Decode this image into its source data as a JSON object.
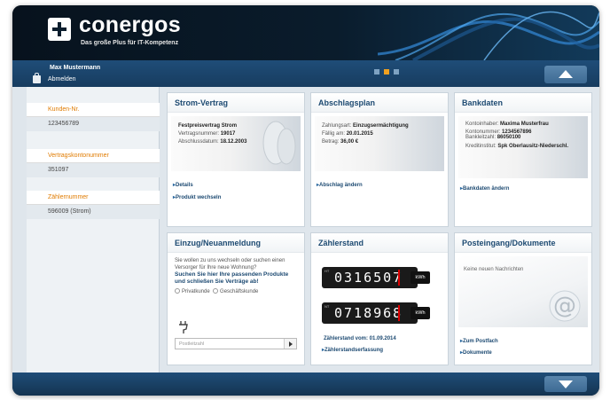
{
  "brand": {
    "name": "conergos",
    "tagline": "Das große Plus für IT-Kompetenz"
  },
  "user": {
    "name": "Max Mustermann",
    "logout_label": "Abmelden"
  },
  "sidebar": {
    "items": [
      {
        "label": "Kunden-Nr.",
        "value": "123456789"
      },
      {
        "label": "Vertragskontonummer",
        "value": "351097"
      },
      {
        "label": "Zählernummer",
        "value": "596009 (Strom)"
      }
    ]
  },
  "panels": {
    "strom": {
      "title": "Strom-Vertrag",
      "heading": "Festpreisvertrag Strom",
      "contract_label": "Vertragsnummer:",
      "contract_value": "19017",
      "date_label": "Abschlussdatum:",
      "date_value": "18.12.2003",
      "link_details": "Details",
      "link_switch": "Produkt wechseln"
    },
    "abschlag": {
      "title": "Abschlagsplan",
      "payment_label": "Zahlungsart:",
      "payment_value": "Einzugsermächtigung",
      "due_label": "Fällig am:",
      "due_value": "20.01.2015",
      "amount_label": "Betrag:",
      "amount_value": "36,00 €",
      "link_change": "Abschlag ändern"
    },
    "bank": {
      "title": "Bankdaten",
      "holder_label": "Kontoinhaber:",
      "holder_value": "Maxima Musterfrau",
      "account_label": "Kontonummer:",
      "account_value": "1234567896",
      "code_label": "Bankleitzahl:",
      "code_value": "86050100",
      "institute_label": "Kreditinstitut:",
      "institute_value": "Spk Oberlausitz-Niederschl.",
      "link_change": "Bankdaten ändern"
    },
    "einzug": {
      "title": "Einzug/Neuanmeldung",
      "intro": "Sie wollen zu uns wechseln oder suchen einen Versorger für Ihre neue Wohnung?",
      "cta": "Suchen Sie hier Ihre passenden Produkte und schließen Sie Verträge ab!",
      "radio_private": "Privatkunde",
      "radio_business": "Geschäftskunde",
      "postcode_placeholder": "Postleitzahl"
    },
    "zaehler": {
      "title": "Zählerstand",
      "meter_ht": "HT",
      "meter_nt": "NT",
      "meter_ht_value": "0316507",
      "meter_nt_value": "0718968",
      "unit": "kWh",
      "date_text": "Zählerstand vom: 01.09.2014",
      "link_entry": "Zählerstandserfassung"
    },
    "post": {
      "title": "Posteingang/Dokumente",
      "message": "Keine neuen Nachrichten",
      "link_inbox": "Zum Postfach",
      "link_docs": "Dokumente"
    }
  },
  "colors": {
    "accent": "#f09a20",
    "primary": "#1d4a72",
    "header": "#0c1e2e"
  }
}
